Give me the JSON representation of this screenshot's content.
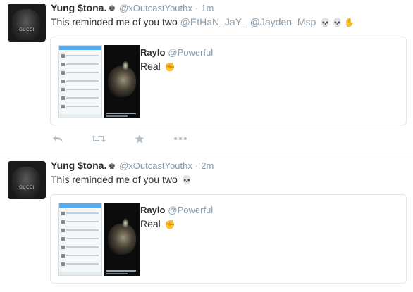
{
  "tweets": [
    {
      "author": {
        "name": "Yung $tona.",
        "crown": "♚",
        "handle": "@xOutcastYouthx",
        "avatar_text": "GUCCI"
      },
      "separator": "·",
      "time": "1m",
      "text": "This reminded me of you two ",
      "mentions": [
        "@EtHaN_JaY_",
        "@Jayden_Msp"
      ],
      "emojis": [
        "💀",
        "💀",
        "✋"
      ],
      "card": {
        "name": "Raylo",
        "handle": "@Powerful",
        "text": "Real ",
        "emoji": "✊"
      }
    },
    {
      "author": {
        "name": "Yung $tona.",
        "crown": "♚",
        "handle": "@xOutcastYouthx",
        "avatar_text": "GUCCI"
      },
      "separator": "·",
      "time": "2m",
      "text": "This reminded me of you two ",
      "emojis": [
        "💀"
      ],
      "card": {
        "name": "Raylo",
        "handle": "@Powerful",
        "text": "Real ",
        "emoji": "✊"
      }
    }
  ],
  "actions": [
    "reply-icon",
    "retweet-icon",
    "favorite-icon",
    "more-icon"
  ],
  "colors": {
    "text": "#292f33",
    "muted": "#8899a6",
    "border": "#e1e8ed",
    "icon": "#b3bfc7"
  }
}
